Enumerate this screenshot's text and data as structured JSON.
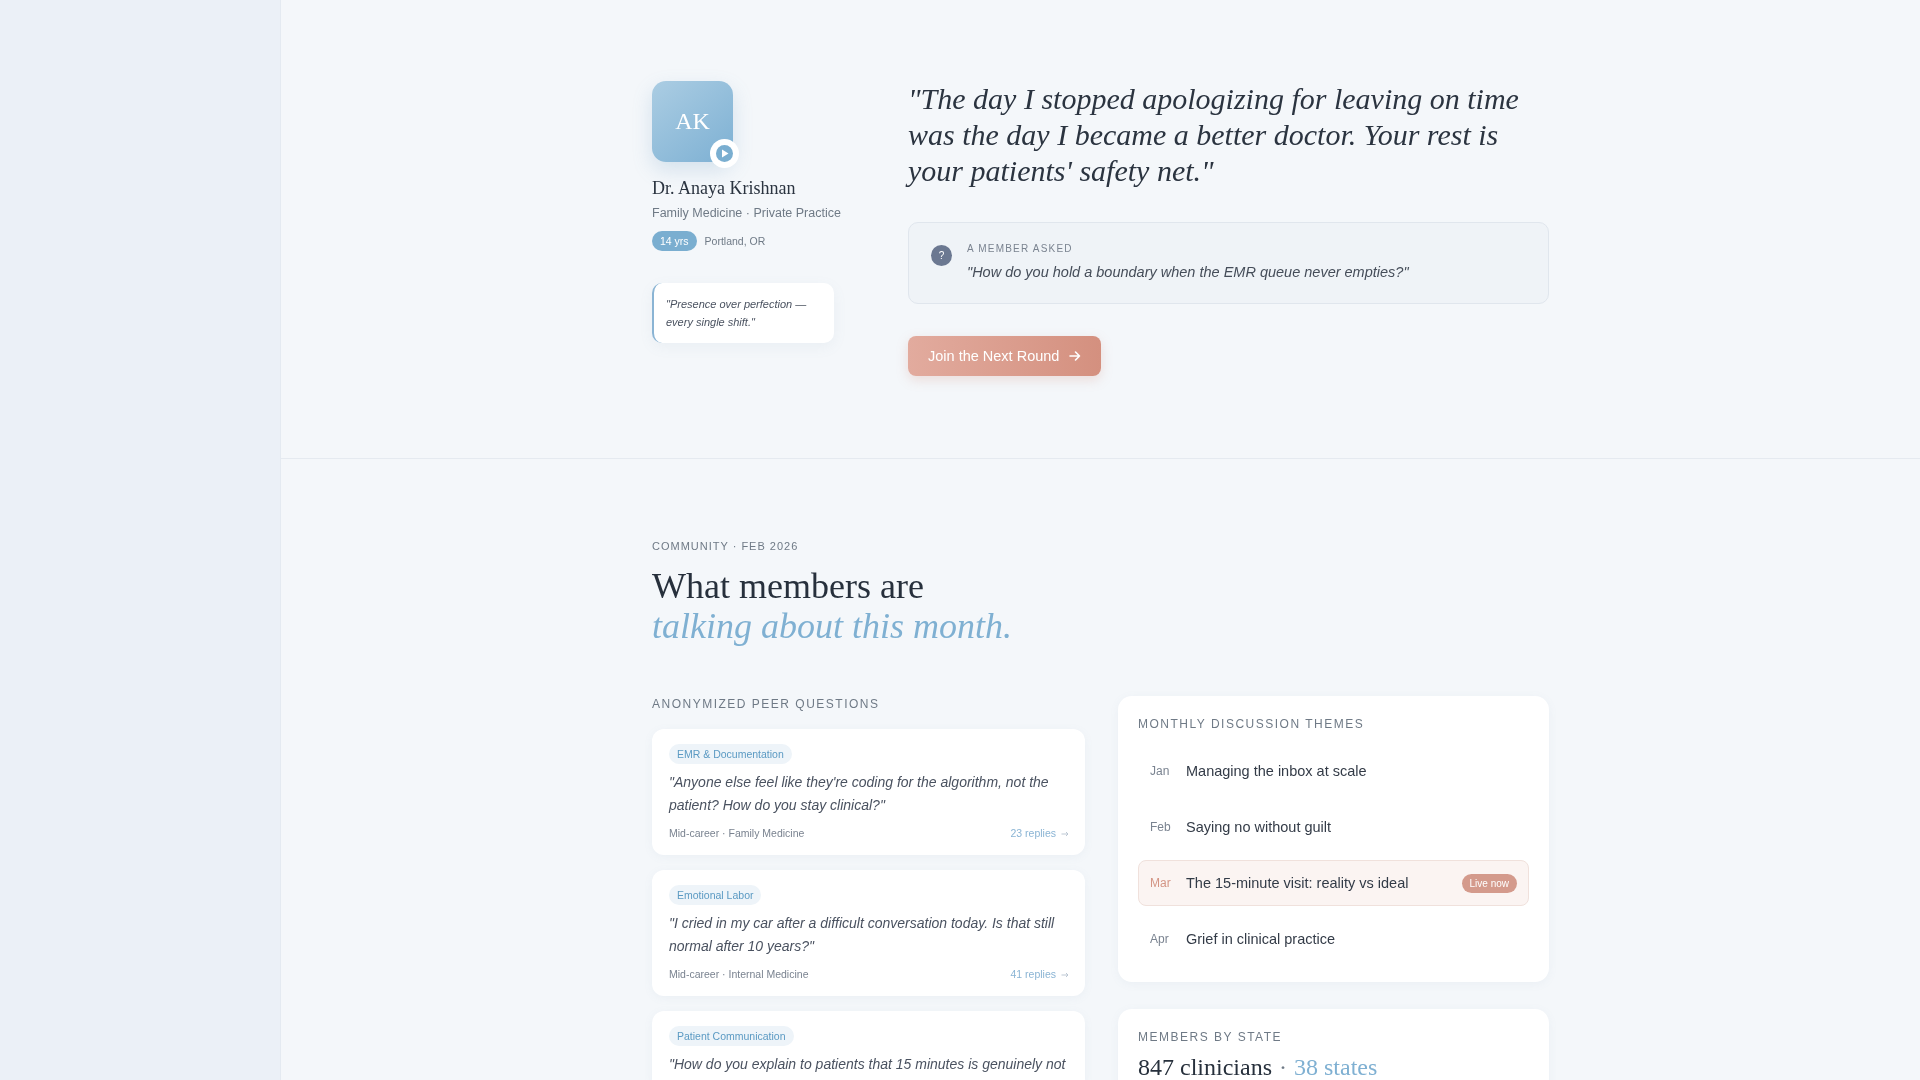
{
  "profile": {
    "initials": "AK",
    "name": "Dr. Anaya Krishnan",
    "specialty": "Family Medicine · Private Practice",
    "experience": "14 yrs",
    "location": "Portland, OR",
    "motto": "\"Presence over perfection — every single shift.\""
  },
  "featured": {
    "quote": "\"The day I stopped apologizing for leaving on time was the day I became a better doctor. Your rest is your patients' safety net.\"",
    "member_question": {
      "icon": "?",
      "label": "A MEMBER ASKED",
      "text": "\"How do you hold a boundary when the EMR queue never empties?\""
    },
    "cta": "Join the Next Round"
  },
  "community": {
    "eyebrow": "COMMUNITY · FEB 2026",
    "title": "What members are",
    "title_accent": "talking about this month.",
    "peer_questions": {
      "heading": "ANONYMIZED PEER QUESTIONS",
      "items": [
        {
          "tag": "EMR & Documentation",
          "text": "\"Anyone else feel like they're coding for the algorithm, not the patient? How do you stay clinical?\"",
          "meta": "Mid-career · Family Medicine",
          "replies": "23 replies"
        },
        {
          "tag": "Emotional Labor",
          "text": "\"I cried in my car after a difficult conversation today. Is that still normal after 10 years?\"",
          "meta": "Mid-career · Internal Medicine",
          "replies": "41 replies"
        },
        {
          "tag": "Patient Communication",
          "text": "\"How do you explain to patients that 15 minutes is genuinely not"
        }
      ]
    },
    "themes": {
      "heading": "MONTHLY DISCUSSION THEMES",
      "items": [
        {
          "month": "Jan",
          "title": "Managing the inbox at scale",
          "current": false
        },
        {
          "month": "Feb",
          "title": "Saying no without guilt",
          "current": false
        },
        {
          "month": "Mar",
          "title": "The 15-minute visit: reality vs ideal",
          "current": true,
          "badge": "Live now"
        },
        {
          "month": "Apr",
          "title": "Grief in clinical practice",
          "current": false
        }
      ]
    },
    "members": {
      "heading": "MEMBERS BY STATE",
      "count": "847 clinicians",
      "separator": "·",
      "states": "38 states"
    }
  }
}
